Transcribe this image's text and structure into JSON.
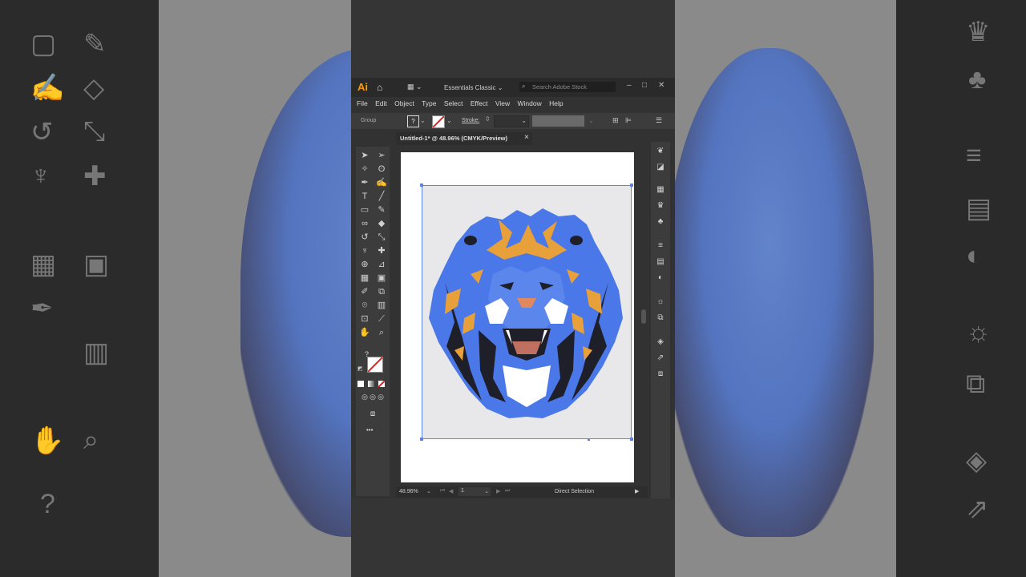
{
  "app": {
    "logo": "Ai",
    "workspace": "Essentials Classic",
    "search_placeholder": "Search Adobe Stock"
  },
  "menu": [
    "File",
    "Edit",
    "Object",
    "Type",
    "Select",
    "Effect",
    "View",
    "Window",
    "Help"
  ],
  "control_bar": {
    "selection_label": "Group",
    "fill_label": "?",
    "stroke_label": "Stroke:"
  },
  "document_tab": {
    "title": "Untitled-1* @ 48.96% (CMYK/Preview)",
    "close": "×"
  },
  "status_bar": {
    "zoom": "48.96%",
    "artboard_number": "1",
    "tool_name": "Direct Selection"
  },
  "toolbar_extra": {
    "more_tools": "•••",
    "swatch_label": "?"
  },
  "colors": {
    "lion_blue": "#4a78e8",
    "lion_orange": "#e8a03a",
    "lion_dark": "#1f1f2a",
    "selection": "#5b83e6"
  }
}
